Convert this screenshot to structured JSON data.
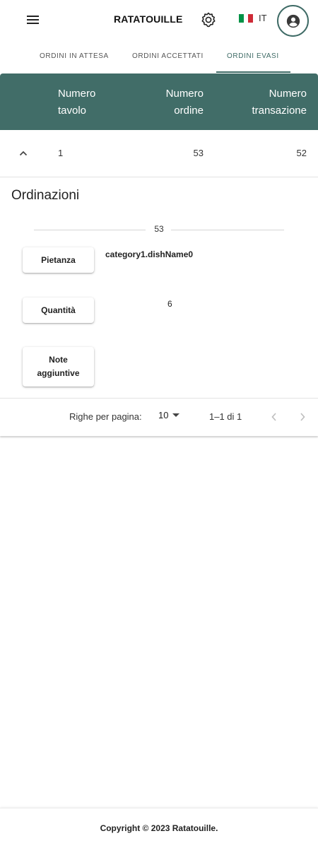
{
  "header": {
    "brand": "RATATOUILLE",
    "language_code": "IT",
    "flag_colors": [
      "#009246",
      "#ffffff",
      "#ce2b37"
    ],
    "icons": {
      "menu": "hamburger-menu-icon",
      "settings": "gear-icon",
      "account": "account-circle-icon"
    }
  },
  "tabs": [
    {
      "label": "ORDINI IN ATTESA",
      "active": false
    },
    {
      "label": "ORDINI ACCETTATI",
      "active": false
    },
    {
      "label": "ORDINI EVASI",
      "active": true
    }
  ],
  "table": {
    "headers": [
      {
        "line1": "Numero",
        "line2": "tavolo"
      },
      {
        "line1": "Numero",
        "line2": "ordine"
      },
      {
        "line1": "Numero",
        "line2": "transazione"
      }
    ],
    "rows": [
      {
        "tavolo": "1",
        "ordine": "53",
        "transazione": "52",
        "expanded": true
      }
    ]
  },
  "details": {
    "title": "Ordinazioni",
    "order_divider": "53",
    "fields": [
      {
        "label_line1": "Pietanza",
        "label_line2": "",
        "value": "category1.dishName0"
      },
      {
        "label_line1": "Quantità",
        "label_line2": "",
        "value": "6"
      },
      {
        "label_line1": "Note",
        "label_line2": "aggiuntive",
        "value": ""
      }
    ]
  },
  "pagination": {
    "rows_per_page_label": "Righe per pagina:",
    "rows_per_page": "10",
    "range": "1–1 di 1"
  },
  "footer": {
    "copyright": "Copyright © 2023 Ratatouille."
  },
  "colors": {
    "accent": "#416d68",
    "tab_active": "#3f6b66"
  }
}
